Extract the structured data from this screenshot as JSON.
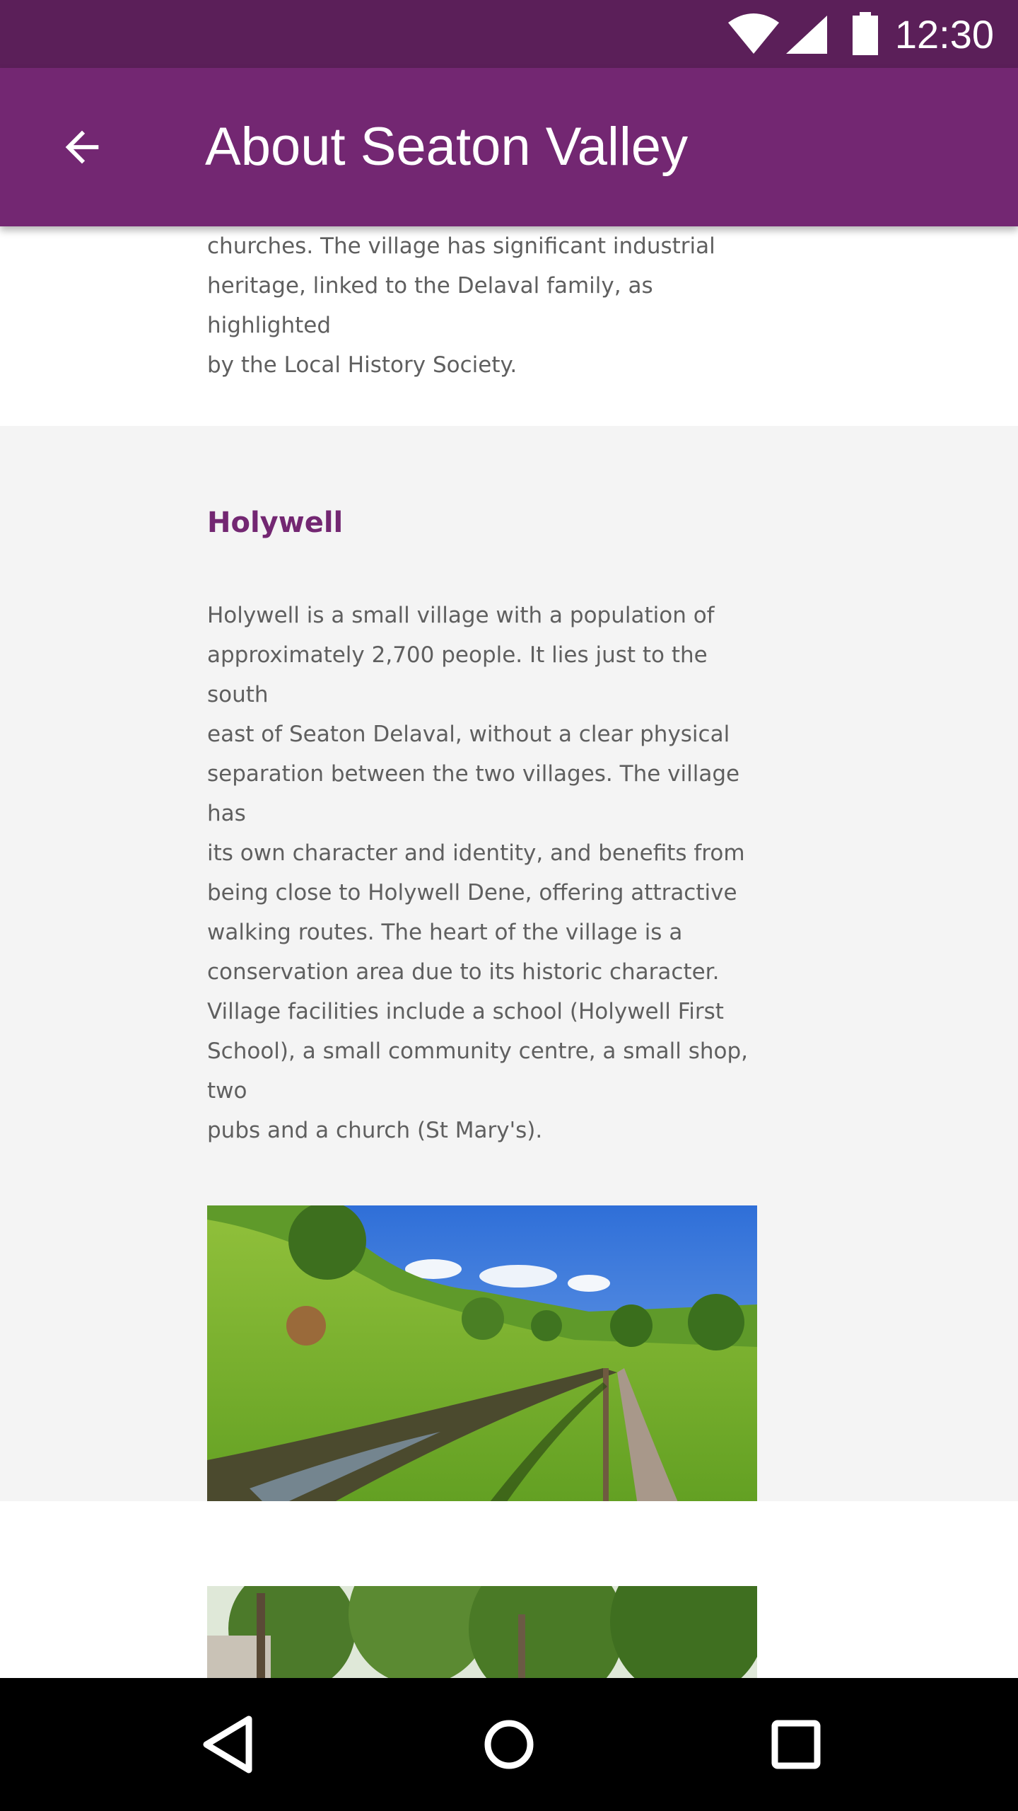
{
  "status_bar": {
    "time": "12:30",
    "icons": [
      "wifi-icon",
      "cell-signal-icon",
      "battery-icon"
    ]
  },
  "app_bar": {
    "title": "About Seaton Valley",
    "back_icon": "arrow-back-icon"
  },
  "sections": {
    "intro_tail": {
      "lines": [
        "churches. The village has significant industrial",
        "heritage, linked to the Delaval family, as highlighted",
        "by the Local History Society."
      ]
    },
    "holywell": {
      "heading": "Holywell",
      "lines": [
        "Holywell is a small village with a population of",
        "approximately 2,700 people. It lies just to the south",
        "east of Seaton Delaval, without a clear physical",
        "separation between the two villages. The village has",
        "its own character and identity, and benefits from",
        "being close to Holywell Dene, offering attractive",
        "walking routes. The heart of the village is a",
        "conservation area due to its historic character.",
        "Village facilities include a school (Holywell First",
        "School), a small community centre, a small shop, two",
        "pubs and a church (St Mary's)."
      ],
      "image": "holywell-dene-photo"
    },
    "next": {
      "image": "trees-photo"
    }
  },
  "nav_bar": {
    "buttons": [
      "back-triangle-icon",
      "home-circle-icon",
      "recents-square-icon"
    ]
  },
  "colors": {
    "status_bar": "#5b1f59",
    "app_bar": "#732772",
    "heading": "#732772",
    "body_text": "#5f5f5f",
    "section_bg": "#f4f4f4"
  }
}
